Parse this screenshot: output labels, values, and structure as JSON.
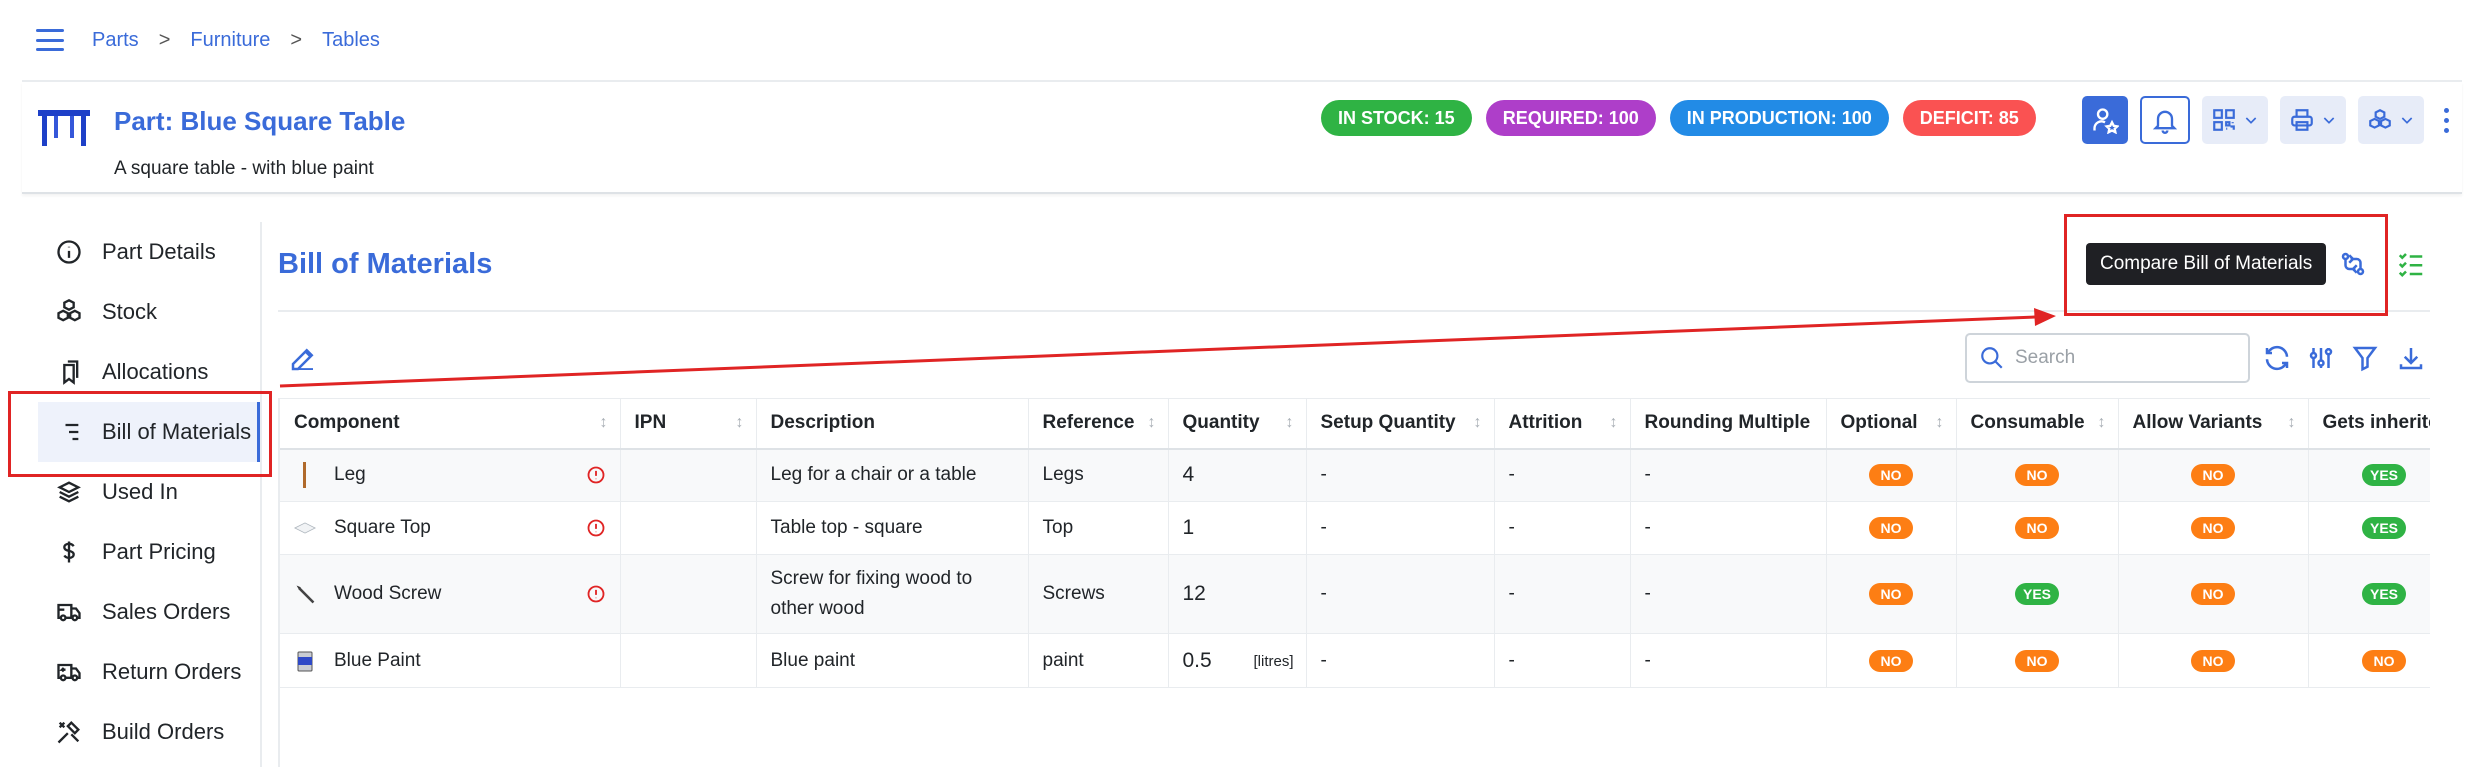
{
  "breadcrumb": [
    "Parts",
    "Furniture",
    "Tables"
  ],
  "part": {
    "title": "Part: Blue Square Table",
    "description": "A square table - with blue paint"
  },
  "badges": [
    {
      "label": "IN STOCK: 15",
      "color": "#2fb344"
    },
    {
      "label": "REQUIRED: 100",
      "color": "#ae3ec9"
    },
    {
      "label": "IN PRODUCTION: 100",
      "color": "#228be6"
    },
    {
      "label": "DEFICIT: 85",
      "color": "#fa5252"
    }
  ],
  "header_actions": [
    "star-icon",
    "bell-icon",
    "qrcode-icon",
    "printer-icon",
    "cubes-icon",
    "kebab-icon"
  ],
  "sidebar": {
    "items": [
      {
        "label": "Part Details",
        "icon": "info-circle-icon"
      },
      {
        "label": "Stock",
        "icon": "boxes-icon"
      },
      {
        "label": "Allocations",
        "icon": "bookmarks-icon"
      },
      {
        "label": "Bill of Materials",
        "icon": "list-tree-icon",
        "active": true
      },
      {
        "label": "Used In",
        "icon": "stack-icon"
      },
      {
        "label": "Part Pricing",
        "icon": "dollar-icon"
      },
      {
        "label": "Sales Orders",
        "icon": "truck-delivery-icon"
      },
      {
        "label": "Return Orders",
        "icon": "truck-return-icon"
      },
      {
        "label": "Build Orders",
        "icon": "tools-icon"
      }
    ]
  },
  "main": {
    "title": "Bill of Materials",
    "tooltip": "Compare Bill of Materials",
    "search_placeholder": "Search"
  },
  "table": {
    "headers": [
      "Component",
      "IPN",
      "Description",
      "Reference",
      "Quantity",
      "Setup Quantity",
      "Attrition",
      "Rounding Multiple",
      "Optional",
      "Consumable",
      "Allow Variants",
      "Gets inherited"
    ],
    "rows": [
      {
        "component": "Leg",
        "ipn": "",
        "description": "Leg for a chair or a table",
        "reference": "Legs",
        "quantity": "4",
        "units": "",
        "setup": "-",
        "attrition": "-",
        "rounding": "-",
        "optional": "NO",
        "consumable": "NO",
        "variants": "NO",
        "inherited": "YES"
      },
      {
        "component": "Square Top",
        "ipn": "",
        "description": "Table top - square",
        "reference": "Top",
        "quantity": "1",
        "units": "",
        "setup": "-",
        "attrition": "-",
        "rounding": "-",
        "optional": "NO",
        "consumable": "NO",
        "variants": "NO",
        "inherited": "YES"
      },
      {
        "component": "Wood Screw",
        "ipn": "",
        "description": "Screw for fixing wood to other wood",
        "reference": "Screws",
        "quantity": "12",
        "units": "",
        "setup": "-",
        "attrition": "-",
        "rounding": "-",
        "optional": "NO",
        "consumable": "YES",
        "variants": "NO",
        "inherited": "YES"
      },
      {
        "component": "Blue Paint",
        "ipn": "",
        "description": "Blue paint",
        "reference": "paint",
        "quantity": "0.5",
        "units": "[litres]",
        "setup": "-",
        "attrition": "-",
        "rounding": "-",
        "optional": "NO",
        "consumable": "NO",
        "variants": "NO",
        "inherited": "NO"
      }
    ]
  },
  "colors": {
    "accent": "#3a6bd9",
    "yes": "#2fb344",
    "no": "#fd7e14",
    "annotation": "#e02424"
  }
}
